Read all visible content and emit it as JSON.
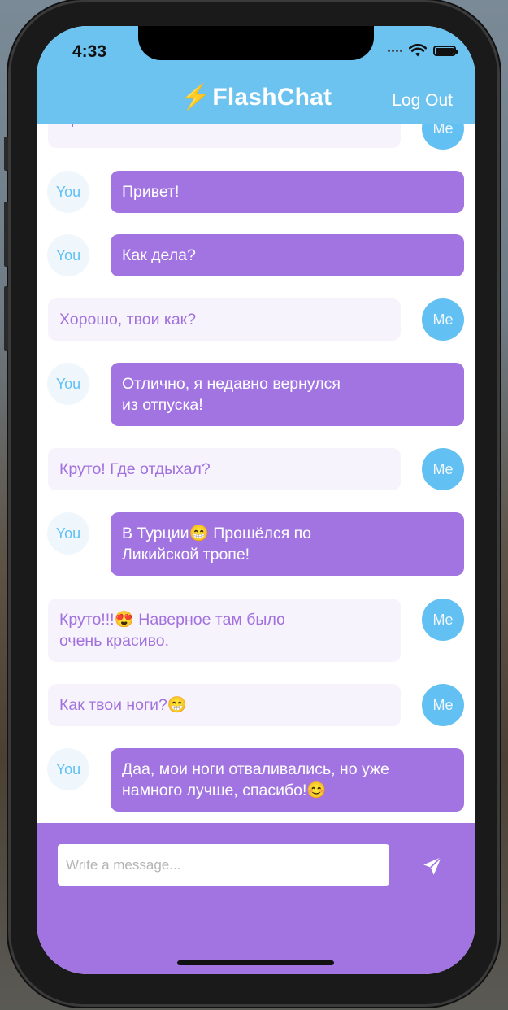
{
  "status_bar": {
    "time": "4:33"
  },
  "header": {
    "bolt": "⚡",
    "title": "FlashChat",
    "logout_label": "Log Out"
  },
  "messages": [
    {
      "sender": "Me",
      "text": "Привет!"
    },
    {
      "sender": "You",
      "text": "Привет!"
    },
    {
      "sender": "You",
      "text": "Как дела?"
    },
    {
      "sender": "Me",
      "text": "Хорошо, твои как?"
    },
    {
      "sender": "You",
      "text": "Отлично, я недавно вернулся\nиз отпуска!"
    },
    {
      "sender": "Me",
      "text": "Круто! Где отдыхал?"
    },
    {
      "sender": "You",
      "text": "В Турции😁 Прошёлся по\nЛикийской тропе!"
    },
    {
      "sender": "Me",
      "text": "Круто!!!😍 Наверное там было\nочень красиво."
    },
    {
      "sender": "Me",
      "text": "Как твои ноги?😁"
    },
    {
      "sender": "You",
      "text": "Даа, мои ноги отваливались, но уже\nнамного лучше, спасибо!😊"
    }
  ],
  "composer": {
    "placeholder": "Write a message...",
    "send_icon": "paper-plane-icon"
  },
  "colors": {
    "header": "#6cc3f0",
    "purple": "#a174e2",
    "light_bubble": "#f7f3fd",
    "avatar_blue": "#62c0f2"
  }
}
